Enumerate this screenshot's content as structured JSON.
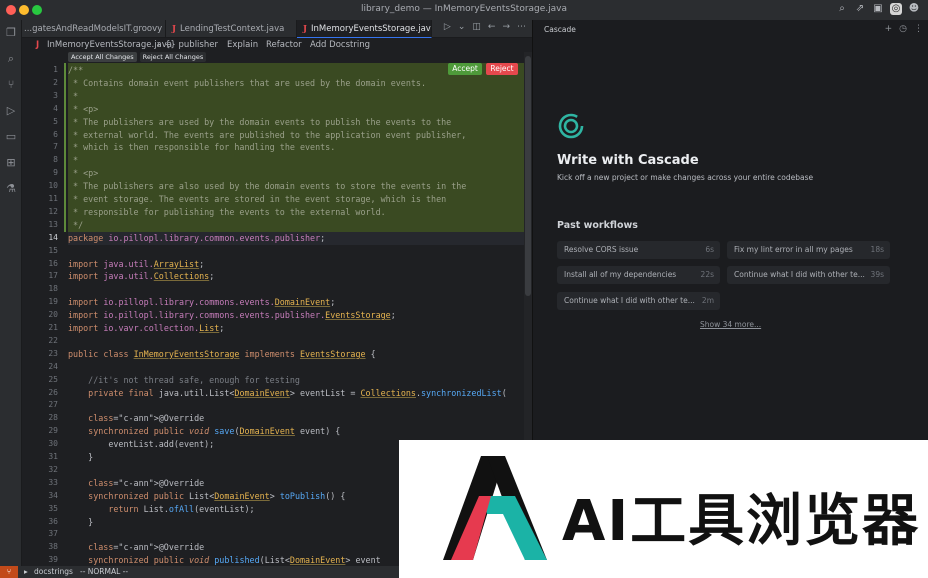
{
  "window": {
    "title": "library_demo — InMemoryEventsStorage.java"
  },
  "tabs": [
    {
      "label": "...gatesAndReadModelsIT.groovy",
      "icon": "groovy-file-icon"
    },
    {
      "label": "LendingTestContext.java",
      "icon": "java-file-icon"
    },
    {
      "label": "InMemoryEventsStorage.java",
      "icon": "java-file-icon",
      "active": true
    }
  ],
  "breadcrumb": {
    "file": "InMemoryEventsStorage.java",
    "symbol": "{} publisher",
    "actions": [
      "Explain",
      "Refactor",
      "Add Docstring"
    ]
  },
  "diff_toolbar": {
    "accept_all": "Accept All Changes",
    "reject_all": "Reject All Changes",
    "accept": "Accept",
    "reject": "Reject"
  },
  "code": {
    "line_numbers": [
      "1",
      "2",
      "3",
      "4",
      "5",
      "6",
      "7",
      "8",
      "9",
      "10",
      "11",
      "12",
      "13",
      "14",
      "15",
      "16",
      "17",
      "18",
      "19",
      "20",
      "21",
      "22",
      "23",
      "24",
      "25",
      "26",
      "27",
      "28",
      "29",
      "30",
      "31",
      "32",
      "33",
      "34",
      "35",
      "36",
      "37",
      "38",
      "39"
    ],
    "current_line": "14",
    "lines": [
      "/**",
      " * Contains domain event publishers that are used by the domain events.",
      " *",
      " * <p>",
      " * The publishers are used by the domain events to publish the events to the",
      " * external world. The events are published to the application event publisher,",
      " * which is then responsible for handling the events.",
      " *",
      " * <p>",
      " * The publishers are also used by the domain events to store the events in the",
      " * event storage. The events are stored in the event storage, which is then",
      " * responsible for publishing the events to the external world.",
      " */",
      "package io.pillopl.library.common.events.publisher;",
      "",
      "import java.util.ArrayList;",
      "import java.util.Collections;",
      "",
      "import io.pillopl.library.commons.events.DomainEvent;",
      "import io.pillopl.library.commons.events.publisher.EventsStorage;",
      "import io.vavr.collection.List;",
      "",
      "public class InMemoryEventsStorage implements EventsStorage {",
      "",
      "    //it's not thread safe, enough for testing",
      "    private final java.util.List<DomainEvent> eventList = Collections.synchronizedList(",
      "",
      "    @Override",
      "    synchronized public void save(DomainEvent event) {",
      "        eventList.add(event);",
      "    }",
      "",
      "    @Override",
      "    synchronized public List<DomainEvent> toPublish() {",
      "        return List.ofAll(eventList);",
      "    }",
      "",
      "    @Override",
      "    synchronized public void published(List<DomainEvent> event"
    ]
  },
  "status_bar": {
    "branch": "⑂",
    "file": "docstrings",
    "mode": "-- NORMAL --"
  },
  "cascade": {
    "panel_title": "Cascade",
    "heading": "Write with Cascade",
    "subheading": "Kick off a new project or make changes across your entire codebase",
    "past_title": "Past workflows",
    "workflows": [
      {
        "label": "Resolve CORS issue",
        "time": "6s"
      },
      {
        "label": "Fix my lint error in all my pages",
        "time": "18s"
      },
      {
        "label": "Install all of my dependencies",
        "time": "22s"
      },
      {
        "label": "Continue what I did with other te...",
        "time": "39s"
      },
      {
        "label": "Continue what I did with other te...",
        "time": "2m"
      }
    ],
    "show_more": "Show 34 more...",
    "accent": "#2fb5a3"
  },
  "promo": {
    "text": "AI工具浏览器",
    "logo": "ai-browser-logo"
  }
}
